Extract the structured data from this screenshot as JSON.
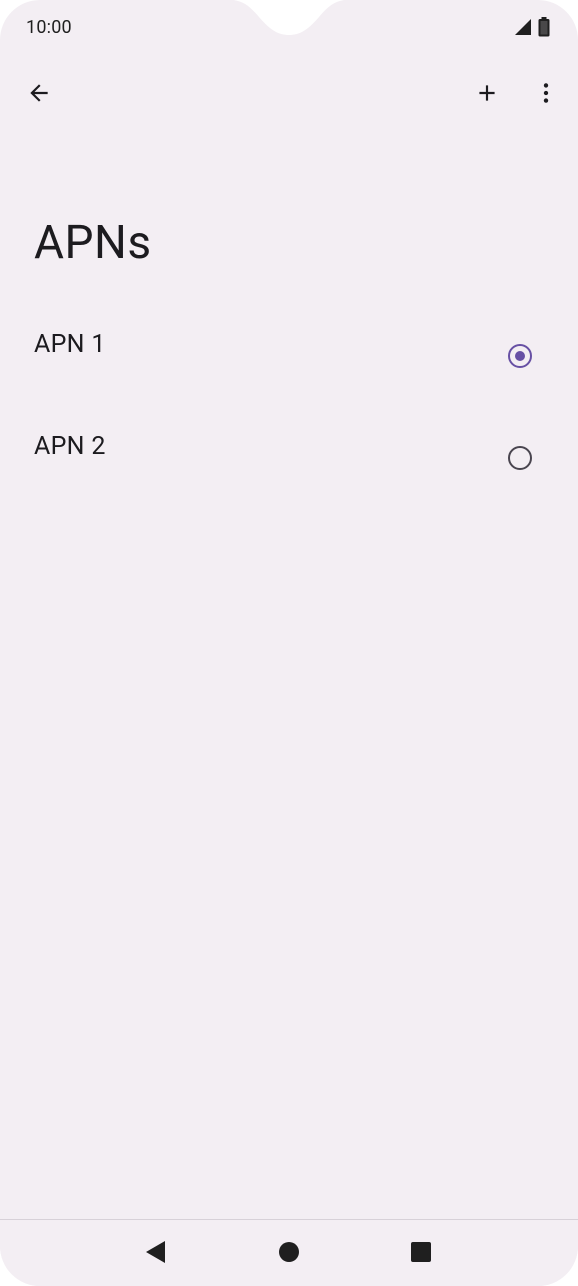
{
  "status_bar": {
    "time": "10:00",
    "icons": [
      "signal-icon",
      "battery-icon"
    ]
  },
  "app_bar": {
    "back_icon": "arrow-left-icon",
    "add_icon": "plus-icon",
    "more_icon": "more-vertical-icon"
  },
  "page": {
    "title": "APNs"
  },
  "apns": [
    {
      "label": "APN 1",
      "selected": true
    },
    {
      "label": "APN 2",
      "selected": false
    }
  ],
  "colors": {
    "background": "#f3eef3",
    "accent": "#6750a4",
    "text": "#1c1b1f"
  },
  "nav_bar": {
    "buttons": [
      "back-triangle-icon",
      "home-circle-icon",
      "recents-square-icon"
    ]
  }
}
